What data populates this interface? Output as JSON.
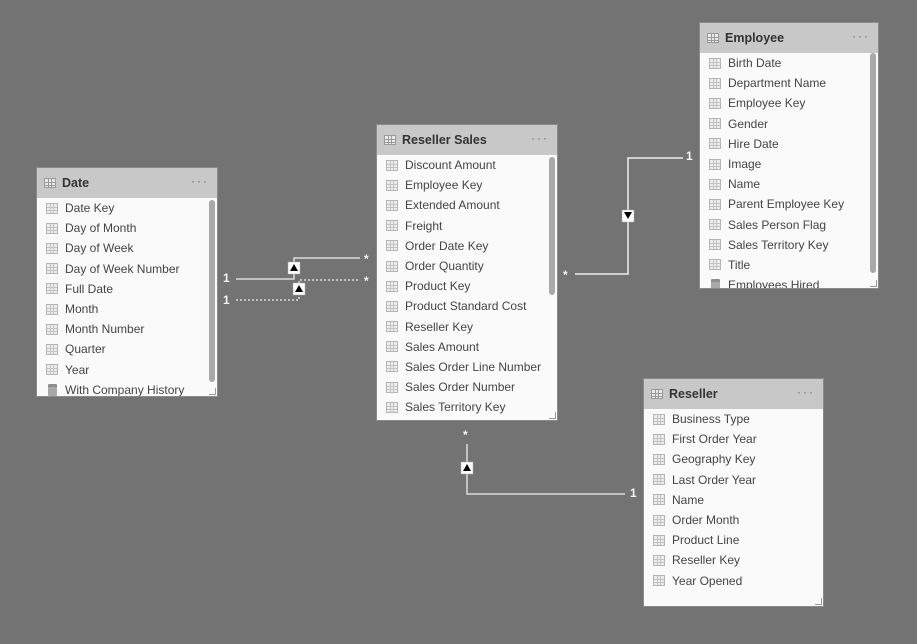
{
  "tables": {
    "date": {
      "title": "Date",
      "more_label": "···",
      "fields": [
        {
          "label": "Date Key",
          "icon": "column-icon"
        },
        {
          "label": "Day of Month",
          "icon": "column-icon"
        },
        {
          "label": "Day of Week",
          "icon": "column-icon"
        },
        {
          "label": "Day of Week Number",
          "icon": "column-icon"
        },
        {
          "label": "Full Date",
          "icon": "column-icon"
        },
        {
          "label": "Month",
          "icon": "column-icon"
        },
        {
          "label": "Month Number",
          "icon": "column-icon"
        },
        {
          "label": "Quarter",
          "icon": "column-icon"
        },
        {
          "label": "Year",
          "icon": "column-icon"
        },
        {
          "label": "With Company History",
          "icon": "measure-icon"
        }
      ]
    },
    "reseller_sales": {
      "title": "Reseller Sales",
      "more_label": "···",
      "fields": [
        {
          "label": "Discount Amount",
          "icon": "column-icon"
        },
        {
          "label": "Employee Key",
          "icon": "column-icon"
        },
        {
          "label": "Extended Amount",
          "icon": "column-icon"
        },
        {
          "label": "Freight",
          "icon": "column-icon"
        },
        {
          "label": "Order Date Key",
          "icon": "column-icon"
        },
        {
          "label": "Order Quantity",
          "icon": "column-icon"
        },
        {
          "label": "Product Key",
          "icon": "column-icon"
        },
        {
          "label": "Product Standard Cost",
          "icon": "column-icon"
        },
        {
          "label": "Reseller Key",
          "icon": "column-icon"
        },
        {
          "label": "Sales Amount",
          "icon": "column-icon"
        },
        {
          "label": "Sales Order Line Number",
          "icon": "column-icon"
        },
        {
          "label": "Sales Order Number",
          "icon": "column-icon"
        },
        {
          "label": "Sales Territory Key",
          "icon": "column-icon"
        }
      ]
    },
    "employee": {
      "title": "Employee",
      "more_label": "···",
      "fields": [
        {
          "label": "Birth Date",
          "icon": "column-icon"
        },
        {
          "label": "Department Name",
          "icon": "column-icon"
        },
        {
          "label": "Employee Key",
          "icon": "column-icon"
        },
        {
          "label": "Gender",
          "icon": "column-icon"
        },
        {
          "label": "Hire Date",
          "icon": "column-icon"
        },
        {
          "label": "Image",
          "icon": "column-icon"
        },
        {
          "label": "Name",
          "icon": "column-icon"
        },
        {
          "label": "Parent Employee Key",
          "icon": "column-icon"
        },
        {
          "label": "Sales Person Flag",
          "icon": "column-icon"
        },
        {
          "label": "Sales Territory Key",
          "icon": "column-icon"
        },
        {
          "label": "Title",
          "icon": "column-icon"
        },
        {
          "label": "Employees Hired",
          "icon": "measure-icon"
        }
      ]
    },
    "reseller": {
      "title": "Reseller",
      "more_label": "···",
      "fields": [
        {
          "label": "Business Type",
          "icon": "column-icon"
        },
        {
          "label": "First Order Year",
          "icon": "column-icon"
        },
        {
          "label": "Geography Key",
          "icon": "column-icon"
        },
        {
          "label": "Last Order Year",
          "icon": "column-icon"
        },
        {
          "label": "Name",
          "icon": "column-icon"
        },
        {
          "label": "Order Month",
          "icon": "column-icon"
        },
        {
          "label": "Product Line",
          "icon": "column-icon"
        },
        {
          "label": "Reseller Key",
          "icon": "column-icon"
        },
        {
          "label": "Year Opened",
          "icon": "column-icon"
        }
      ]
    }
  },
  "relationships": [
    {
      "from": "Date",
      "to": "Reseller Sales",
      "from_cardinality": "1",
      "to_cardinality": "*",
      "active": true,
      "filter_direction": "single"
    },
    {
      "from": "Date",
      "to": "Reseller Sales",
      "from_cardinality": "1",
      "to_cardinality": "*",
      "active": false,
      "filter_direction": "single"
    },
    {
      "from": "Employee",
      "to": "Reseller Sales",
      "from_cardinality": "1",
      "to_cardinality": "*",
      "active": true,
      "filter_direction": "single"
    },
    {
      "from": "Reseller",
      "to": "Reseller Sales",
      "from_cardinality": "1",
      "to_cardinality": "*",
      "active": true,
      "filter_direction": "single"
    }
  ],
  "labels": {
    "one": "1",
    "many": "*"
  }
}
